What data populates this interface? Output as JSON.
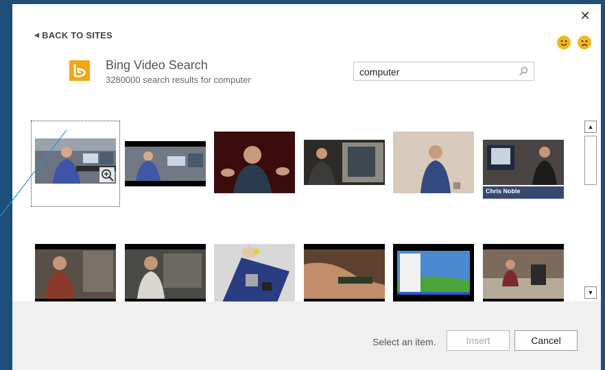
{
  "dialog": {
    "back_label": "BACK TO SITES",
    "close_icon": "close-icon",
    "feedback": {
      "happy_icon": "smiley-happy-icon",
      "sad_icon": "smiley-sad-icon"
    }
  },
  "provider": {
    "name": "Bing Video Search",
    "result_summary": "3280000 search results for computer",
    "logo_icon": "bing-logo-icon",
    "accent": "#f4a516"
  },
  "search": {
    "value": "computer",
    "icon": "search-icon"
  },
  "results": {
    "selected_index": 0,
    "rows": [
      [
        {
          "name": "video-thumb-1",
          "caption": ""
        },
        {
          "name": "video-thumb-2",
          "caption": ""
        },
        {
          "name": "video-thumb-3",
          "caption": ""
        },
        {
          "name": "video-thumb-4",
          "caption": ""
        },
        {
          "name": "video-thumb-5",
          "caption": ""
        },
        {
          "name": "video-thumb-6",
          "caption": "Chris Noble"
        }
      ],
      [
        {
          "name": "video-thumb-7",
          "caption": ""
        },
        {
          "name": "video-thumb-8",
          "caption": ""
        },
        {
          "name": "video-thumb-9",
          "caption": ""
        },
        {
          "name": "video-thumb-10",
          "caption": ""
        },
        {
          "name": "video-thumb-11",
          "caption": ""
        },
        {
          "name": "video-thumb-12",
          "caption": ""
        }
      ]
    ]
  },
  "footer": {
    "status": "Select an item.",
    "insert_label": "Insert",
    "cancel_label": "Cancel"
  }
}
